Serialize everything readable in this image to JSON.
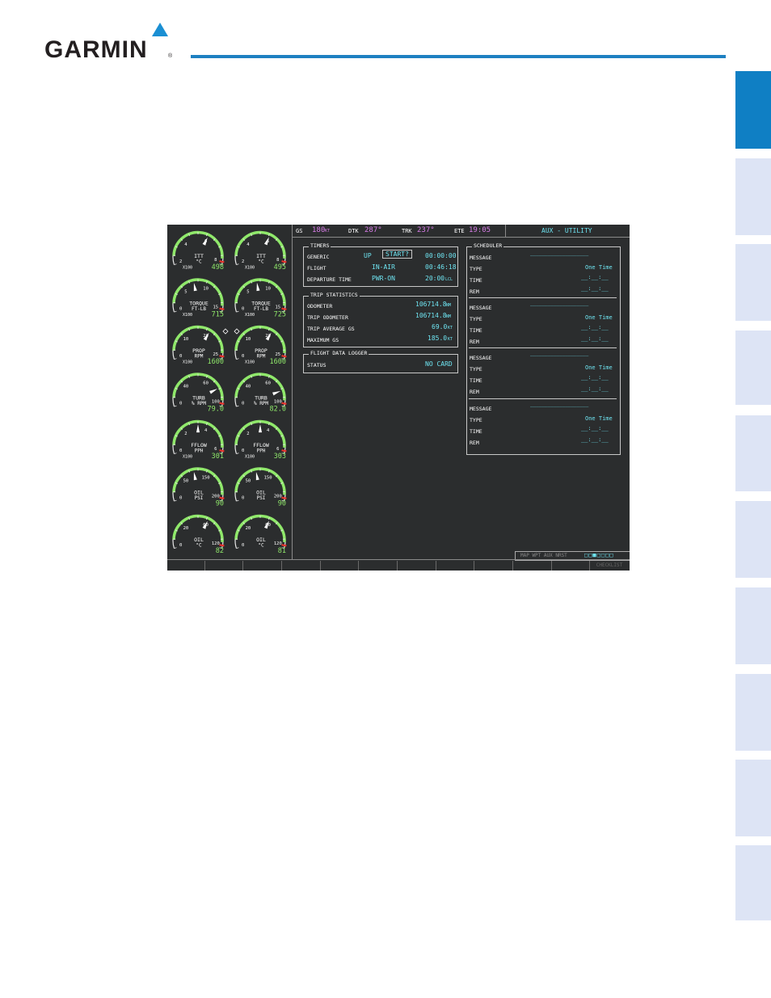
{
  "header": {
    "logo_text": "GARMIN"
  },
  "screen": {
    "topbar": {
      "gs_label": "GS",
      "gs_value": "180",
      "gs_unit": "KT",
      "dtk_label": "DTK",
      "dtk_value": "287°",
      "trk_label": "TRK",
      "trk_value": "237°",
      "ete_label": "ETE",
      "ete_value": "19:05",
      "page_title": "AUX - UTILITY"
    },
    "timers": {
      "title": "TIMERS",
      "rows": [
        {
          "label": "GENERIC",
          "mode": "UP",
          "button": "START?",
          "value": "00:00:00",
          "unit": ""
        },
        {
          "label": "FLIGHT",
          "mode": "IN-AIR",
          "button": "",
          "value": "00:46:18",
          "unit": ""
        },
        {
          "label": "DEPARTURE TIME",
          "mode": "PWR-ON",
          "button": "",
          "value": "20:00",
          "unit": "LCL"
        }
      ]
    },
    "trip": {
      "title": "TRIP STATISTICS",
      "rows": [
        {
          "label": "ODOMETER",
          "value": "106714.8",
          "unit": "NM"
        },
        {
          "label": "TRIP ODOMETER",
          "value": "106714.8",
          "unit": "NM"
        },
        {
          "label": "TRIP AVERAGE GS",
          "value": "69.0",
          "unit": "KT"
        },
        {
          "label": "MAXIMUM GS",
          "value": "185.0",
          "unit": "KT"
        }
      ]
    },
    "logger": {
      "title": "FLIGHT DATA LOGGER",
      "status_label": "STATUS",
      "status_value": "NO CARD"
    },
    "scheduler": {
      "title": "SCHEDULER",
      "groups": [
        {
          "message_label": "MESSAGE",
          "message_value": "____________________",
          "type_label": "TYPE",
          "type_value": "One Time",
          "time_label": "TIME",
          "time_value": "__:__:__",
          "rem_label": "REM",
          "rem_value": "__:__:__"
        },
        {
          "message_label": "MESSAGE",
          "message_value": "____________________",
          "type_label": "TYPE",
          "type_value": "One Time",
          "time_label": "TIME",
          "time_value": "__:__:__",
          "rem_label": "REM",
          "rem_value": "__:__:__"
        },
        {
          "message_label": "MESSAGE",
          "message_value": "____________________",
          "type_label": "TYPE",
          "type_value": "One Time",
          "time_label": "TIME",
          "time_value": "__:__:__",
          "rem_label": "REM",
          "rem_value": "__:__:__"
        },
        {
          "message_label": "MESSAGE",
          "message_value": "____________________",
          "type_label": "TYPE",
          "type_value": "One Time",
          "time_label": "TIME",
          "time_value": "__:__:__",
          "rem_label": "REM",
          "rem_value": "__:__:__"
        }
      ]
    },
    "gauges": [
      {
        "name": "ITT",
        "sub": "°C",
        "mult": "X100",
        "value": "498",
        "t0": "2",
        "t1": "4",
        "t2": "6",
        "t3": "8",
        "level": 0.62
      },
      {
        "name": "ITT",
        "sub": "°C",
        "mult": "X100",
        "value": "495",
        "t0": "2",
        "t1": "4",
        "t2": "6",
        "t3": "8",
        "level": 0.61
      },
      {
        "name": "TORQUE",
        "sub": "FT-LB",
        "mult": "X100",
        "value": "715",
        "t0": "0",
        "t1": "5",
        "t2": "10",
        "t3": "15",
        "level": 0.45
      },
      {
        "name": "TORQUE",
        "sub": "FT-LB",
        "mult": "X100",
        "value": "725",
        "t0": "0",
        "t1": "5",
        "t2": "10",
        "t3": "15",
        "level": 0.46
      },
      {
        "name": "PROP",
        "sub": "RPM",
        "mult": "X100",
        "value": "1600",
        "t0": "0",
        "t1": "10",
        "t2": "20",
        "t3": "25",
        "level": 0.64
      },
      {
        "name": "PROP",
        "sub": "RPM",
        "mult": "X100",
        "value": "1600",
        "t0": "0",
        "t1": "10",
        "t2": "20",
        "t3": "25",
        "level": 0.64
      },
      {
        "name": "TURB",
        "sub": "% RPM",
        "mult": "",
        "value": "79.0",
        "t0": "0",
        "t1": "40",
        "t2": "60",
        "t3": "100",
        "level": 0.79
      },
      {
        "name": "TURB",
        "sub": "% RPM",
        "mult": "",
        "value": "82.0",
        "t0": "0",
        "t1": "40",
        "t2": "60",
        "t3": "100",
        "level": 0.82
      },
      {
        "name": "FFLOW",
        "sub": "PPH",
        "mult": "X100",
        "value": "301",
        "t0": "0",
        "t1": "2",
        "t2": "4",
        "t3": "6",
        "level": 0.5
      },
      {
        "name": "FFLOW",
        "sub": "PPH",
        "mult": "X100",
        "value": "303",
        "t0": "0",
        "t1": "2",
        "t2": "4",
        "t3": "6",
        "level": 0.5
      },
      {
        "name": "OIL",
        "sub": "PSI",
        "mult": "",
        "value": "90",
        "t0": "0",
        "t1": "50",
        "t2": "150",
        "t3": "200",
        "level": 0.45
      },
      {
        "name": "OIL",
        "sub": "PSI",
        "mult": "",
        "value": "90",
        "t0": "0",
        "t1": "50",
        "t2": "150",
        "t3": "200",
        "level": 0.45
      },
      {
        "name": "OIL",
        "sub": "°C",
        "mult": "",
        "value": "82",
        "t0": "0",
        "t1": "20",
        "t2": "60",
        "t3": "120",
        "level": 0.62
      },
      {
        "name": "OIL",
        "sub": "°C",
        "mult": "",
        "value": "81",
        "t0": "0",
        "t1": "20",
        "t2": "60",
        "t3": "120",
        "level": 0.61
      }
    ],
    "page_group": {
      "text": "MAP WPT AUX NRST",
      "active": "AUX"
    },
    "softkey_last": "CHECKLIST",
    "colors": {
      "cyan": "#6ee3f0",
      "green": "#8fe86a",
      "magenta": "#d97de8",
      "bezel": "#2b2d2e"
    }
  }
}
